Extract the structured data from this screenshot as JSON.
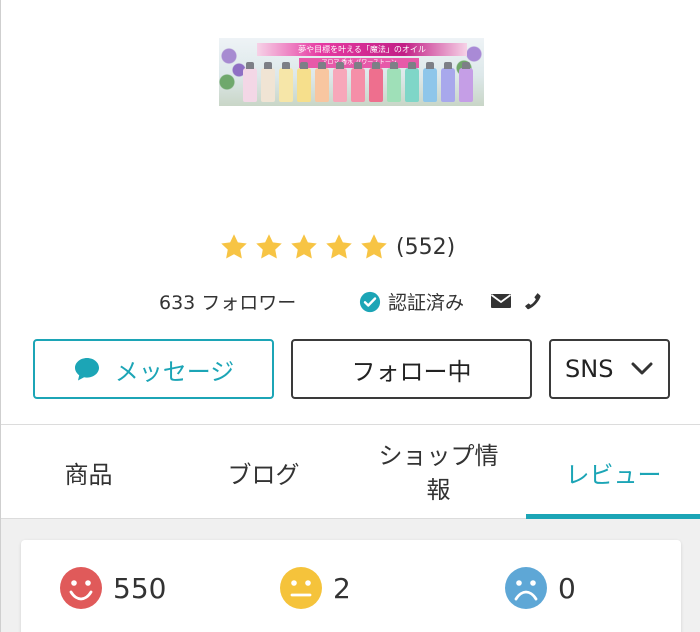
{
  "banner": {
    "title": "夢や目標を叶える「魔法」のオイル",
    "subtitle": "アロマ 香水 パワーストーン"
  },
  "shop": {
    "rating_stars": 5,
    "rating_count": "(552)",
    "followers": "633 フォロワー",
    "verified_label": "認証済み"
  },
  "buttons": {
    "message": "メッセージ",
    "follow": "フォロー中",
    "sns": "SNS"
  },
  "tabs": [
    {
      "label": "商品"
    },
    {
      "label": "ブログ"
    },
    {
      "label": "ショップ情報"
    },
    {
      "label": "レビュー",
      "active": true
    }
  ],
  "reviews": {
    "good": "550",
    "normal": "2",
    "bad": "0"
  },
  "colors": {
    "accent": "#1ca5b6",
    "star": "#f7c444",
    "good": "#e05a5a",
    "normal": "#f5c33b",
    "bad": "#5ea7d6"
  },
  "icons": {
    "rating": "star-icon",
    "verified": "check-circle-icon",
    "mail": "mail-icon",
    "phone": "phone-icon",
    "message": "chat-bubble-icon",
    "sns": "chevron-down-icon",
    "good": "smile-face-icon",
    "normal": "neutral-face-icon",
    "bad": "sad-face-icon"
  }
}
